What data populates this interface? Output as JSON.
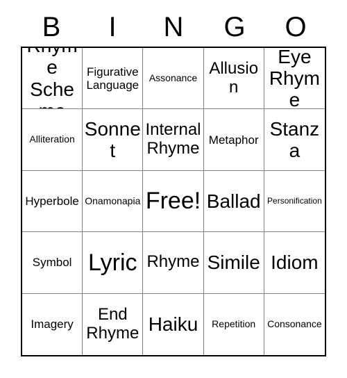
{
  "card": {
    "title": "BINGO Card",
    "header_letters": [
      "B",
      "I",
      "N",
      "G",
      "O"
    ],
    "grid": {
      "columns": 5,
      "rows": 5,
      "free_space_label": "Free!",
      "cells": [
        {
          "text": "Rhyme Scheme",
          "size": "lg",
          "free": false
        },
        {
          "text": "Figurative Language",
          "size": "sm",
          "free": false
        },
        {
          "text": "Assonance",
          "size": "xs",
          "free": false
        },
        {
          "text": "Allusion",
          "size": "md",
          "free": false
        },
        {
          "text": "Eye Rhyme",
          "size": "lg",
          "free": false
        },
        {
          "text": "Alliteration",
          "size": "xs",
          "free": false
        },
        {
          "text": "Sonnet",
          "size": "lg",
          "free": false
        },
        {
          "text": "Internal Rhyme",
          "size": "md",
          "free": false
        },
        {
          "text": "Metaphor",
          "size": "sm",
          "free": false
        },
        {
          "text": "Stanza",
          "size": "lg",
          "free": false
        },
        {
          "text": "Hyperbole",
          "size": "sm",
          "free": false
        },
        {
          "text": "Onamonapia",
          "size": "xs",
          "free": false
        },
        {
          "text": "Free!",
          "size": "xl",
          "free": true
        },
        {
          "text": "Ballad",
          "size": "lg",
          "free": false
        },
        {
          "text": "Personification",
          "size": "xxs",
          "free": false
        },
        {
          "text": "Symbol",
          "size": "sm",
          "free": false
        },
        {
          "text": "Lyric",
          "size": "xl",
          "free": false
        },
        {
          "text": "Rhyme",
          "size": "md",
          "free": false
        },
        {
          "text": "Simile",
          "size": "lg",
          "free": false
        },
        {
          "text": "Idiom",
          "size": "lg",
          "free": false
        },
        {
          "text": "Imagery",
          "size": "sm",
          "free": false
        },
        {
          "text": "End Rhyme",
          "size": "md",
          "free": false
        },
        {
          "text": "Haiku",
          "size": "lg",
          "free": false
        },
        {
          "text": "Repetition",
          "size": "xs",
          "free": false
        },
        {
          "text": "Consonance",
          "size": "xs",
          "free": false
        }
      ]
    },
    "colors": {
      "background": "#ffffff",
      "text": "#000000",
      "outer_border": "#000000",
      "inner_grid_line": "#808080"
    }
  }
}
